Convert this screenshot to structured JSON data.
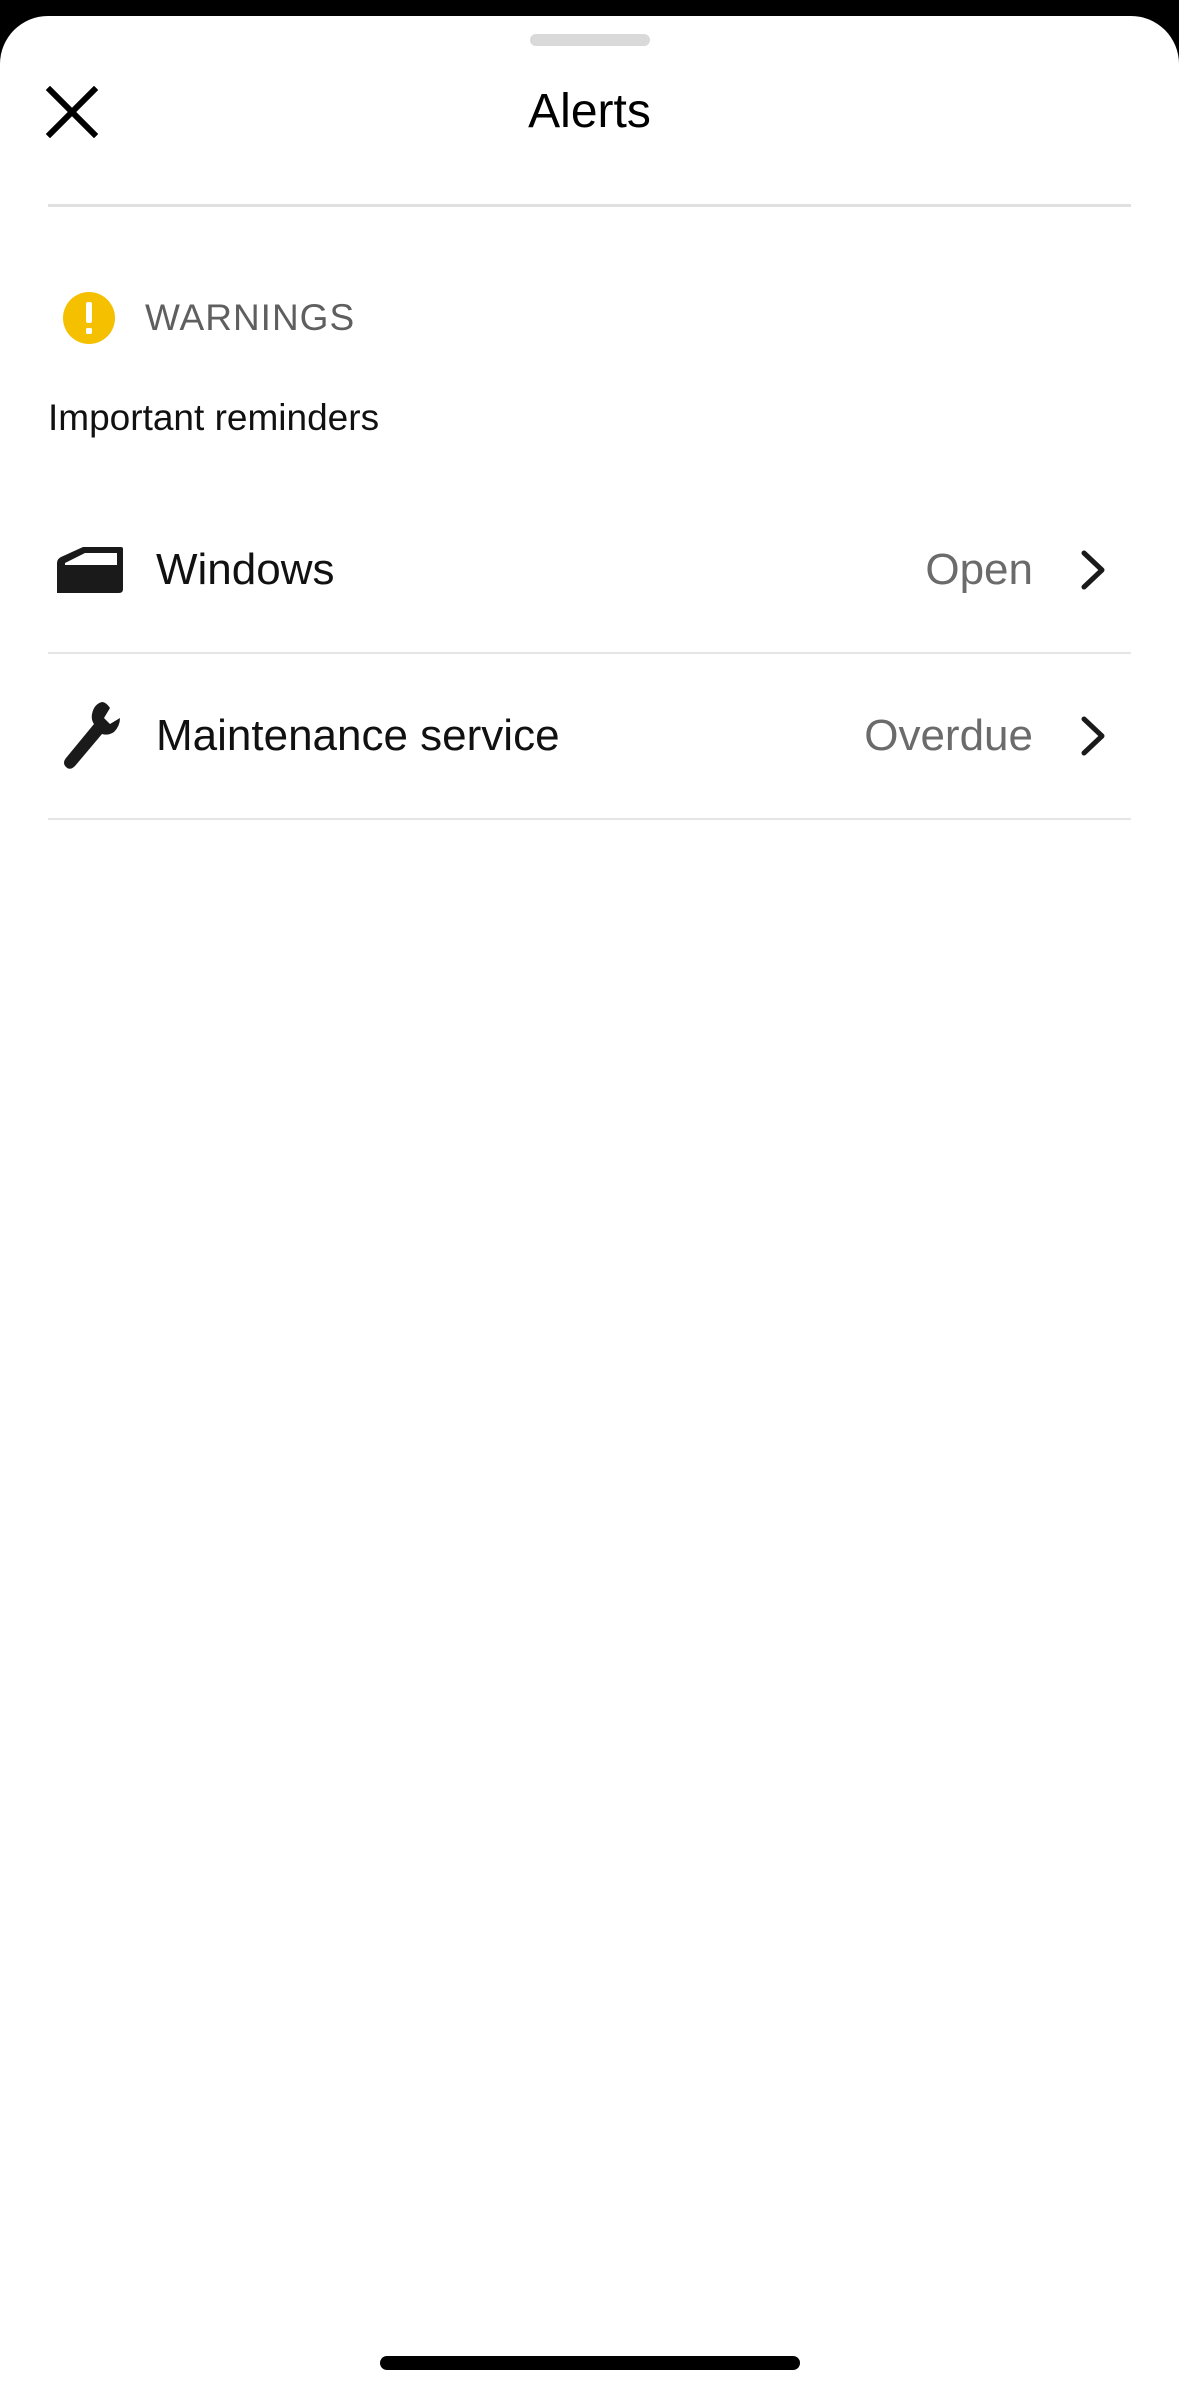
{
  "header": {
    "title": "Alerts",
    "close_icon": "close-icon"
  },
  "warnings": {
    "icon": "exclamation-icon",
    "icon_color": "#f5c000",
    "title": "WARNINGS",
    "subtitle": "Important reminders",
    "items": [
      {
        "icon": "car-window-icon",
        "label": "Windows",
        "value": "Open"
      },
      {
        "icon": "wrench-icon",
        "label": "Maintenance service",
        "value": "Overdue"
      }
    ]
  }
}
